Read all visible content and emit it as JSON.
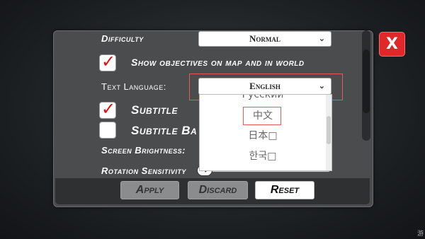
{
  "settings": {
    "difficulty_label": "Difficulty",
    "difficulty_value": "Normal",
    "show_objectives_label": "Show objectives on map and in world",
    "show_objectives_checked": true,
    "text_language_label": "Text Language:",
    "text_language_value": "English",
    "subtitle_label": "Subtitle",
    "subtitle_checked": true,
    "subtitle_bg_label": "Subtitle Ba",
    "subtitle_bg_checked": false,
    "screen_brightness_label": "Screen Brightness:",
    "rotation_sensitivity_label": "Rotation Sensitivity"
  },
  "language_options": [
    "Русский",
    "中文",
    "日本□",
    "한국□"
  ],
  "language_highlighted": "中文",
  "buttons": {
    "apply": "Apply",
    "discard": "Discard",
    "reset": "Reset",
    "close": "X"
  },
  "icons": {
    "chevron": "chevron-down-icon",
    "check": "checkmark-icon",
    "slider_knob": "arrow-right-icon"
  },
  "colors": {
    "close_red": "#e02828",
    "check_red": "#d11111",
    "highlight_outline": "#e05a5a"
  },
  "corner_text": "游"
}
